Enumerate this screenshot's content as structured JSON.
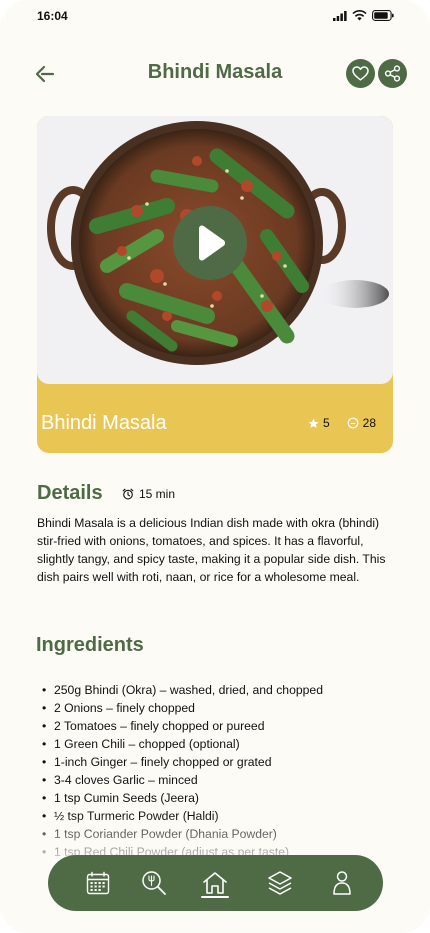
{
  "status_bar": {
    "time": "16:04"
  },
  "header": {
    "title": "Bhindi Masala"
  },
  "hero": {
    "title": "Bhindi Masala",
    "rating": "5",
    "comments": "28"
  },
  "details": {
    "heading": "Details",
    "time": "15 min",
    "description": "Bhindi Masala is a delicious Indian dish made with okra (bhindi) stir-fried with onions, tomatoes, and spices. It has a flavorful, slightly tangy, and spicy taste, making it a popular side dish. This dish pairs well with roti, naan, or rice for a wholesome meal."
  },
  "ingredients": {
    "heading": "Ingredients",
    "items": [
      "250g Bhindi (Okra) – washed, dried, and chopped",
      "2 Onions – finely chopped",
      "2 Tomatoes – finely chopped or pureed",
      "1 Green Chili – chopped (optional)",
      "1-inch Ginger – finely chopped or grated",
      "3-4 cloves Garlic – minced",
      "1 tsp Cumin Seeds (Jeera)",
      "½ tsp Turmeric Powder (Haldi)",
      "1 tsp Coriander Powder (Dhania Powder)",
      "1 tsp Red Chili Powder (adjust as per taste)"
    ]
  },
  "bottom_nav": {
    "items": [
      "calendar-icon",
      "search-recipe-icon",
      "home-icon",
      "layers-icon",
      "profile-icon"
    ],
    "active": "home-icon"
  },
  "colors": {
    "primary": "#4f6b45",
    "accent": "#e9c553",
    "background": "#fcfbf6"
  }
}
